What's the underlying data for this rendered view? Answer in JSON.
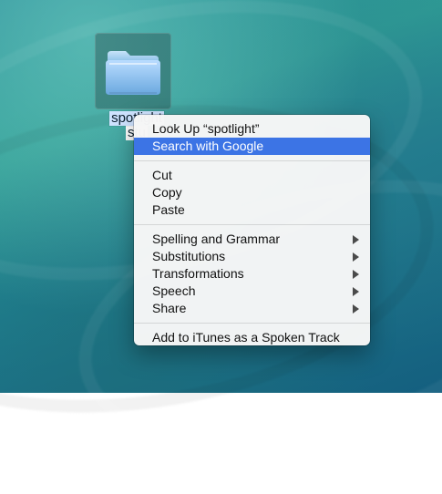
{
  "desktop": {
    "file": {
      "label_line1": "spotlight",
      "label_line2": "stu",
      "icon": "folder-icon"
    }
  },
  "context_menu": {
    "highlight_color": "#3c74e5",
    "items": [
      {
        "label": "Look Up “spotlight”",
        "type": "item"
      },
      {
        "label": "Search with Google",
        "type": "item",
        "highlighted": true
      },
      {
        "type": "separator"
      },
      {
        "label": "Cut",
        "type": "item"
      },
      {
        "label": "Copy",
        "type": "item"
      },
      {
        "label": "Paste",
        "type": "item"
      },
      {
        "type": "separator"
      },
      {
        "label": "Spelling and Grammar",
        "type": "submenu",
        "icon": "chevron-right-icon"
      },
      {
        "label": "Substitutions",
        "type": "submenu",
        "icon": "chevron-right-icon"
      },
      {
        "label": "Transformations",
        "type": "submenu",
        "icon": "chevron-right-icon"
      },
      {
        "label": "Speech",
        "type": "submenu",
        "icon": "chevron-right-icon"
      },
      {
        "label": "Share",
        "type": "submenu",
        "icon": "chevron-right-icon"
      },
      {
        "type": "separator"
      },
      {
        "label": "Add to iTunes as a Spoken Track",
        "type": "item"
      }
    ]
  }
}
